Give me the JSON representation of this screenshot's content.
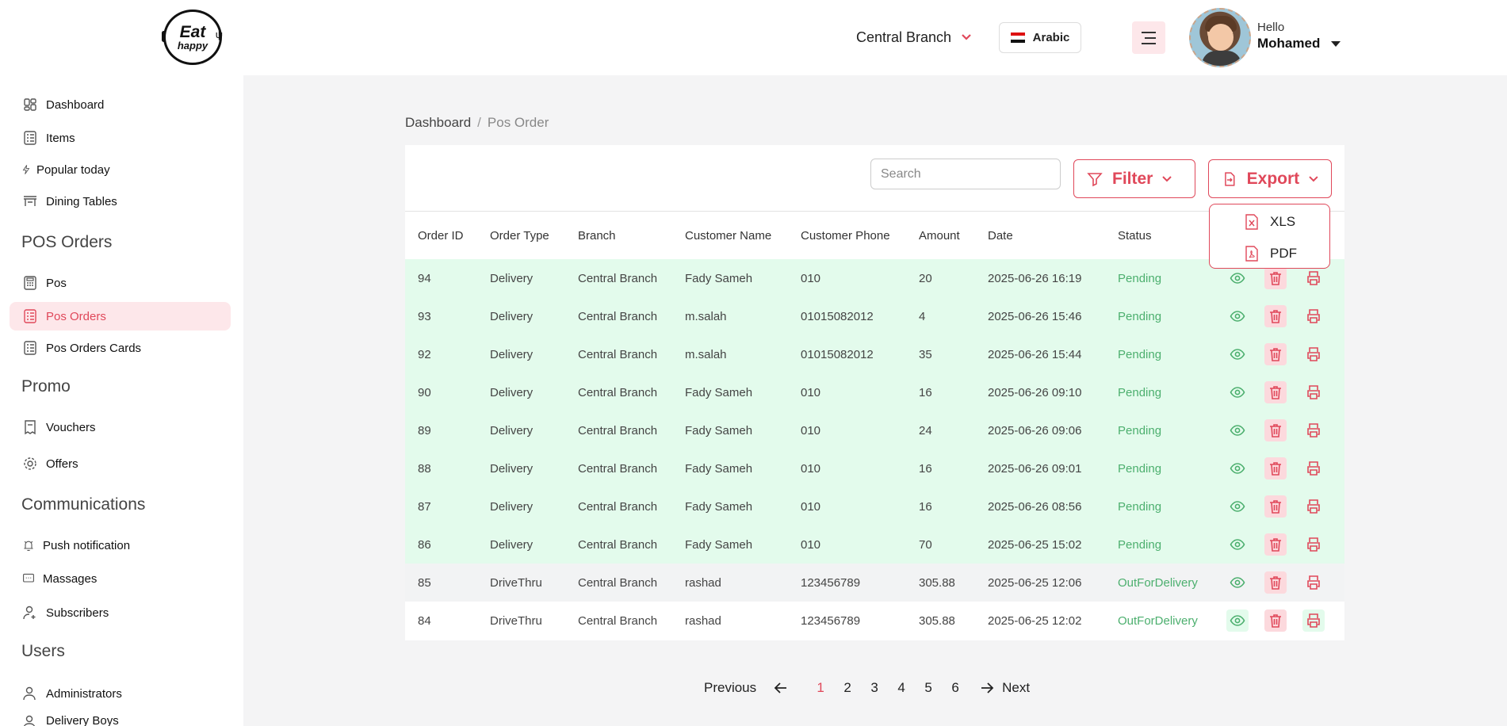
{
  "header": {
    "logo_line1": "Eat",
    "logo_line2": "happy",
    "branch": "Central Branch",
    "language": "Arabic",
    "greeting": "Hello",
    "user_name": "Mohamed"
  },
  "sidebar": {
    "items": [
      {
        "label": "Dashboard",
        "icon": "dashboard-icon"
      },
      {
        "label": "Items",
        "icon": "list-icon"
      },
      {
        "label": "Popular today",
        "icon": "bolt-icon"
      },
      {
        "label": "Dining Tables",
        "icon": "table-icon"
      }
    ],
    "sections": [
      "POS Orders",
      "Promo",
      "Communications",
      "Users"
    ],
    "pos_items": [
      {
        "label": "Pos",
        "icon": "pos-icon"
      },
      {
        "label": "Pos Orders",
        "icon": "orders-icon",
        "active": true
      },
      {
        "label": "Pos Orders Cards",
        "icon": "cards-icon"
      }
    ],
    "promo_items": [
      {
        "label": "Vouchers",
        "icon": "voucher-icon"
      },
      {
        "label": "Offers",
        "icon": "gear-icon"
      }
    ],
    "comm_items": [
      {
        "label": "Push notification",
        "icon": "bell-icon"
      },
      {
        "label": "Massages",
        "icon": "message-icon"
      },
      {
        "label": "Subscribers",
        "icon": "user-plus-icon"
      }
    ],
    "user_items": [
      {
        "label": "Administrators",
        "icon": "user-icon"
      },
      {
        "label": "Delivery Boys",
        "icon": "user-icon"
      }
    ]
  },
  "breadcrumb": {
    "home": "Dashboard",
    "separator": "/",
    "current": "Pos Order"
  },
  "toolbar": {
    "search_placeholder": "Search",
    "filter_label": "Filter",
    "export_label": "Export",
    "export_options": [
      "XLS",
      "PDF"
    ]
  },
  "table": {
    "columns": [
      "Order ID",
      "Order Type",
      "Branch",
      "Customer Name",
      "Customer Phone",
      "Amount",
      "Date",
      "Status"
    ],
    "rows": [
      {
        "id": "94",
        "type": "Delivery",
        "branch": "Central Branch",
        "customer": "Fady Sameh",
        "phone": "010",
        "amount": "20",
        "date": "2025-06-26 16:19",
        "status": "Pending"
      },
      {
        "id": "93",
        "type": "Delivery",
        "branch": "Central Branch",
        "customer": "m.salah",
        "phone": "01015082012",
        "amount": "4",
        "date": "2025-06-26 15:46",
        "status": "Pending"
      },
      {
        "id": "92",
        "type": "Delivery",
        "branch": "Central Branch",
        "customer": "m.salah",
        "phone": "01015082012",
        "amount": "35",
        "date": "2025-06-26 15:44",
        "status": "Pending"
      },
      {
        "id": "90",
        "type": "Delivery",
        "branch": "Central Branch",
        "customer": "Fady Sameh",
        "phone": "010",
        "amount": "16",
        "date": "2025-06-26 09:10",
        "status": "Pending"
      },
      {
        "id": "89",
        "type": "Delivery",
        "branch": "Central Branch",
        "customer": "Fady Sameh",
        "phone": "010",
        "amount": "24",
        "date": "2025-06-26 09:06",
        "status": "Pending"
      },
      {
        "id": "88",
        "type": "Delivery",
        "branch": "Central Branch",
        "customer": "Fady Sameh",
        "phone": "010",
        "amount": "16",
        "date": "2025-06-26 09:01",
        "status": "Pending"
      },
      {
        "id": "87",
        "type": "Delivery",
        "branch": "Central Branch",
        "customer": "Fady Sameh",
        "phone": "010",
        "amount": "16",
        "date": "2025-06-26 08:56",
        "status": "Pending"
      },
      {
        "id": "86",
        "type": "Delivery",
        "branch": "Central Branch",
        "customer": "Fady Sameh",
        "phone": "010",
        "amount": "70",
        "date": "2025-06-25 15:02",
        "status": "Pending"
      },
      {
        "id": "85",
        "type": "DriveThru",
        "branch": "Central Branch",
        "customer": "rashad",
        "phone": "123456789",
        "amount": "305.88",
        "date": "2025-06-25 12:06",
        "status": "OutForDelivery"
      },
      {
        "id": "84",
        "type": "DriveThru",
        "branch": "Central Branch",
        "customer": "rashad",
        "phone": "123456789",
        "amount": "305.88",
        "date": "2025-06-25 12:02",
        "status": "OutForDelivery"
      }
    ]
  },
  "pagination": {
    "previous": "Previous",
    "next": "Next",
    "pages": [
      "1",
      "2",
      "3",
      "4",
      "5",
      "6"
    ],
    "current": "1"
  },
  "colors": {
    "accent": "#e0485a",
    "pending_row": "#e3fbec",
    "status_green": "#4caf6e"
  }
}
